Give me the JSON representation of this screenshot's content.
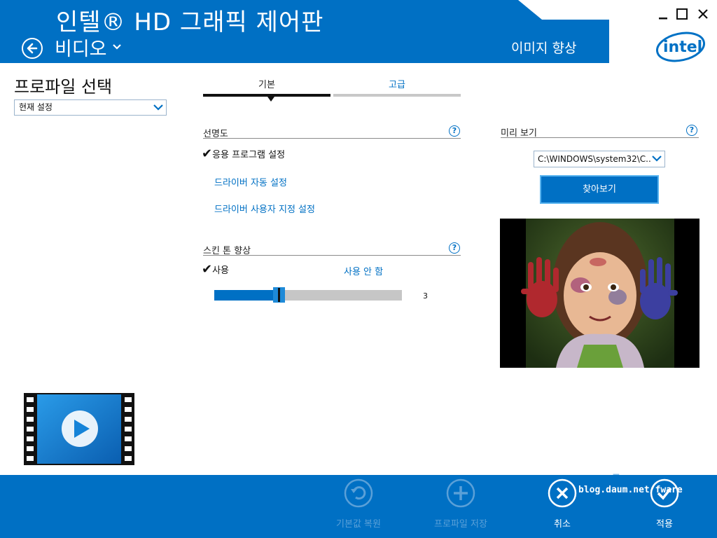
{
  "header": {
    "app_title": "인텔® HD 그래픽 제어판",
    "section": "비디오",
    "page_subtitle": "이미지 향상",
    "brand_logo": "intel"
  },
  "profile": {
    "heading": "프로파일 선택",
    "selected": "현재 설정"
  },
  "tabs": [
    {
      "label": "기본",
      "active": true
    },
    {
      "label": "고급",
      "active": false
    }
  ],
  "sharpness": {
    "title": "선명도",
    "options": [
      {
        "label": "응용 프로그램 설정",
        "checked": true
      },
      {
        "label": "드라이버 자동 설정",
        "checked": false
      },
      {
        "label": "드라이버 사용자 지정 설정",
        "checked": false
      }
    ]
  },
  "skin_tone": {
    "title": "스킨 톤 향상",
    "enable_label": "사용",
    "disable_label": "사용 안 함",
    "value": "3",
    "level_fraction": 0.33
  },
  "preview": {
    "title": "미리 보기",
    "file": "C:\\WINDOWS\\system32\\C...",
    "browse_label": "찾아보기"
  },
  "footer": {
    "restore_label": "기본값 복원",
    "save_profile_label": "프로파일 저장",
    "cancel_label": "취소",
    "apply_label": "적용",
    "watermark": "blog.daum.net/fware",
    "watermark_logo": "Fware"
  },
  "colors": {
    "accent": "#0070c4",
    "footer": "#0070c4",
    "disabled": "#5aa0d8"
  },
  "icons": [
    "back-arrow-icon",
    "chevron-down-icon",
    "minimize-icon",
    "maximize-icon",
    "close-icon",
    "help-icon",
    "checkmark-icon",
    "video-file-icon",
    "undo-icon",
    "plus-icon",
    "cancel-x-icon",
    "apply-check-icon"
  ]
}
